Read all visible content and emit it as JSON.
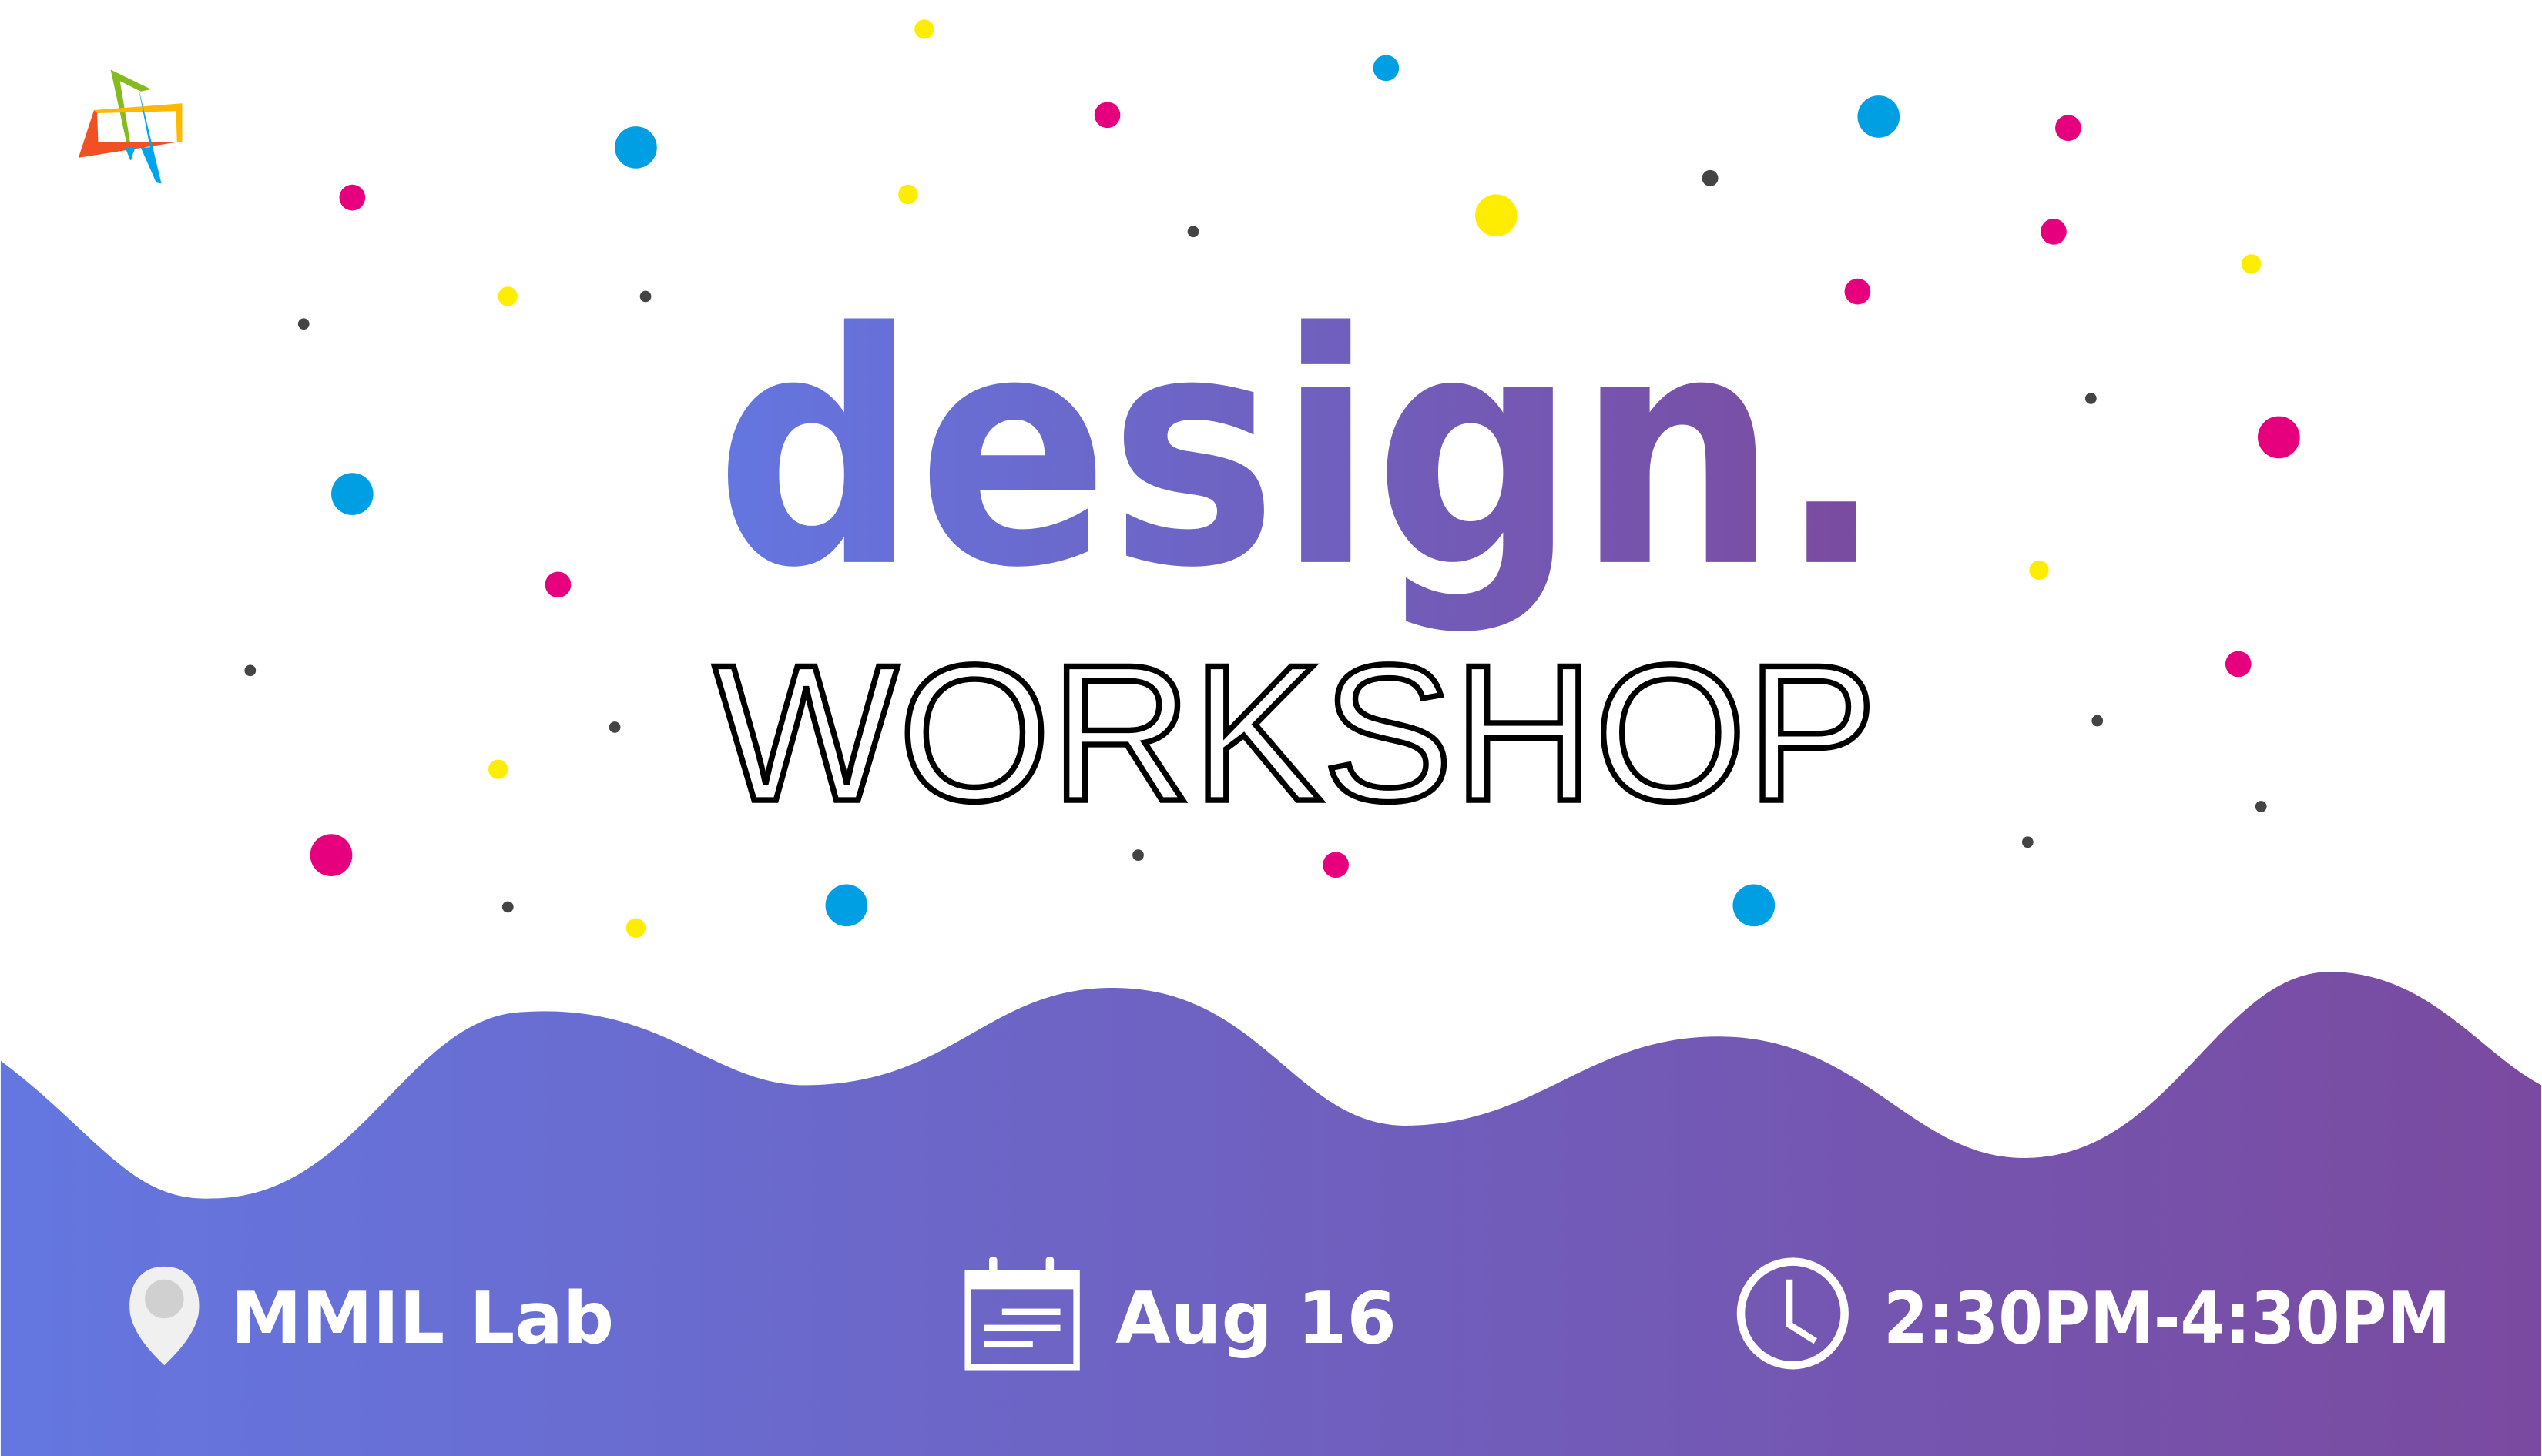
{
  "title": {
    "main": "design.",
    "sub": "WORKSHOP"
  },
  "details": {
    "location": "MMIL Lab",
    "date": "Aug 16",
    "time": "2:30PM-4:30PM"
  },
  "icons": {
    "logo": "mmil-logo",
    "location": "map-pin-icon",
    "date": "calendar-icon",
    "time": "clock-icon"
  },
  "colors": {
    "gradient_start": "#6477e0",
    "gradient_end": "#7a4aa0",
    "dot_pink": "#e6007e",
    "dot_blue": "#009fe3",
    "dot_yellow": "#ffed00",
    "dot_dark": "#444444"
  }
}
